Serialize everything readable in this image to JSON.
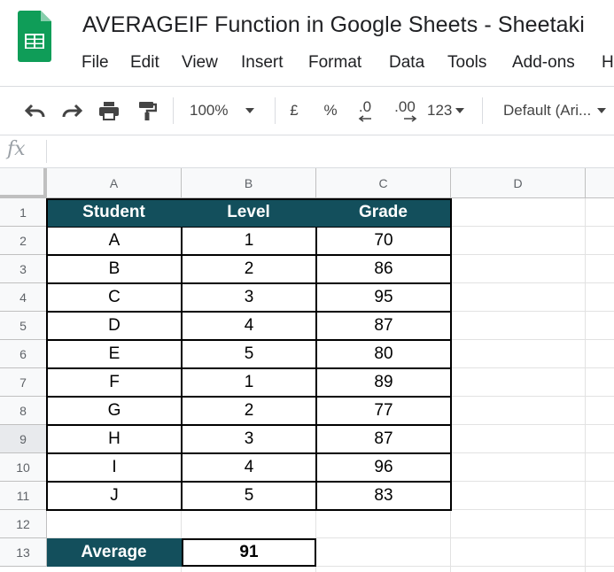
{
  "app": {
    "title": "AVERAGEIF Function in Google Sheets - Sheetaki",
    "brand_color": "#0f9d58"
  },
  "menu": [
    "File",
    "Edit",
    "View",
    "Insert",
    "Format",
    "Data",
    "Tools",
    "Add-ons",
    "H"
  ],
  "toolbar": {
    "zoom": "100%",
    "currency": "£",
    "percent": "%",
    "decrease_decimal": ".0",
    "increase_decimal": ".00",
    "number_format": "123",
    "font": "Default (Ari..."
  },
  "formula_bar": {
    "label": "fx",
    "value": ""
  },
  "grid": {
    "columns": [
      "A",
      "B",
      "C",
      "D"
    ],
    "rows": [
      "1",
      "2",
      "3",
      "4",
      "5",
      "6",
      "7",
      "8",
      "9",
      "10",
      "11",
      "12",
      "13"
    ],
    "selected_row": "9",
    "header_fill": "#134f5c",
    "table_header": [
      "Student",
      "Level",
      "Grade"
    ],
    "table_rows": [
      [
        "A",
        "1",
        "70"
      ],
      [
        "B",
        "2",
        "86"
      ],
      [
        "C",
        "3",
        "95"
      ],
      [
        "D",
        "4",
        "87"
      ],
      [
        "E",
        "5",
        "80"
      ],
      [
        "F",
        "1",
        "89"
      ],
      [
        "G",
        "2",
        "77"
      ],
      [
        "H",
        "3",
        "87"
      ],
      [
        "I",
        "4",
        "96"
      ],
      [
        "J",
        "5",
        "83"
      ]
    ],
    "average_label": "Average",
    "average_value": "91"
  }
}
